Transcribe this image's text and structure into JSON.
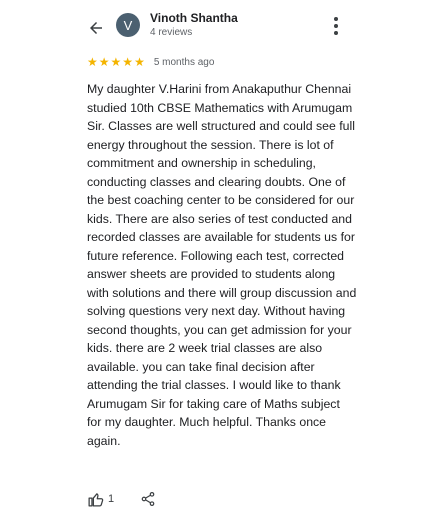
{
  "header": {
    "reviewer_name": "Vinoth Shantha",
    "review_count": "4 reviews",
    "avatar_letter": "V",
    "back_icon": "arrow-left-icon",
    "more_icon": "more-vert-icon"
  },
  "review": {
    "rating": 5,
    "rating_max": 5,
    "time_ago": "5 months ago",
    "text": "My daughter V.Harini from Anakaputhur Chennai studied 10th CBSE Mathematics with Arumugam Sir. Classes are well structured and could see full energy throughout the session. There is lot of commitment and ownership in scheduling, conducting classes and clearing doubts. One of the best coaching center to be considered for our kids. There are also series of test conducted and recorded classes are available for students us for future reference. Following each test, corrected answer sheets are provided to students along with solutions and there will group discussion and solving questions very next day. Without having second thoughts, you can get admission for your kids. there are 2 week trial classes are also available. you can take final decision after attending the trial classes. I would like to thank Arumugam Sir for taking care of Maths subject for my daughter. Much helpful. Thanks once again."
  },
  "actions": {
    "like_count": "1",
    "like_icon": "thumb-up-icon",
    "share_icon": "share-icon"
  },
  "colors": {
    "star": "#f4b400",
    "avatar_bg": "#4b6070"
  }
}
